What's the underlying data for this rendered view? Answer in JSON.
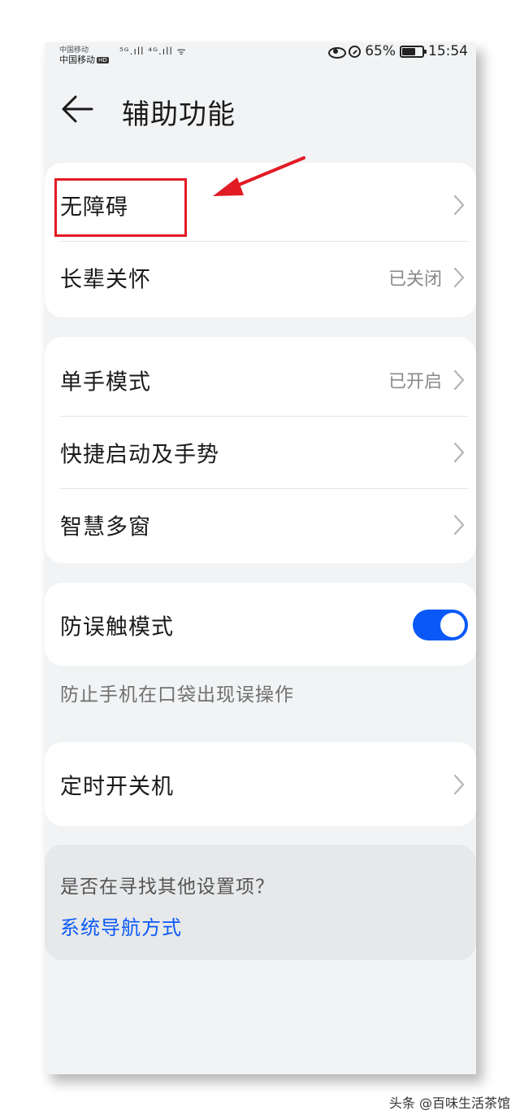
{
  "status_bar": {
    "carrier_line1": "中国移动",
    "carrier": "中国移动",
    "hd_badge": "HD",
    "signals": "⁵ᴳ.ıll ⁴ᴳ.ıll ᯤ",
    "battery": "65%",
    "battery_level": 0.65,
    "time": "15:54"
  },
  "header": {
    "title": "辅助功能"
  },
  "group1": [
    {
      "label": "无障碍",
      "value": ""
    },
    {
      "label": "长辈关怀",
      "value": "已关闭"
    }
  ],
  "group2": [
    {
      "label": "单手模式",
      "value": "已开启"
    },
    {
      "label": "快捷启动及手势",
      "value": ""
    },
    {
      "label": "智慧多窗",
      "value": ""
    }
  ],
  "group3": {
    "label": "防误触模式",
    "toggle_on": true,
    "description": "防止手机在口袋出现误操作"
  },
  "group4": [
    {
      "label": "定时开关机",
      "value": ""
    }
  ],
  "suggest": {
    "title": "是否在寻找其他设置项？",
    "link": "系统导航方式"
  },
  "colors": {
    "accent": "#0a59f7",
    "annotation": "#e21b24",
    "background": "#f1f3f5"
  },
  "watermark": "头条 @百味生活茶馆"
}
